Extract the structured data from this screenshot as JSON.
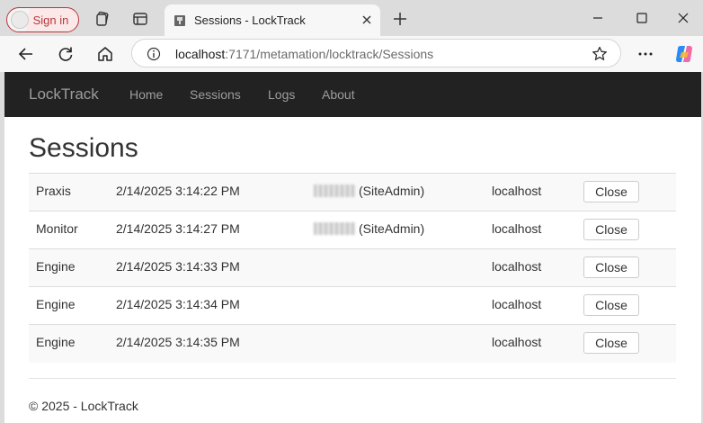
{
  "browser": {
    "sign_in_label": "Sign in",
    "tab_title": "Sessions - LockTrack",
    "url_host": "localhost",
    "url_rest": ":7171/metamation/locktrack/Sessions"
  },
  "navbar": {
    "brand": "LockTrack",
    "links": [
      "Home",
      "Sessions",
      "Logs",
      "About"
    ]
  },
  "page": {
    "title": "Sessions"
  },
  "sessions": {
    "close_label": "Close",
    "rows": [
      {
        "process": "Praxis",
        "started": "2/14/2025 3:14:22 PM",
        "user_role": "(SiteAdmin)",
        "host": "localhost"
      },
      {
        "process": "Monitor",
        "started": "2/14/2025 3:14:27 PM",
        "user_role": "(SiteAdmin)",
        "host": "localhost"
      },
      {
        "process": "Engine",
        "started": "2/14/2025 3:14:33 PM",
        "user_role": "",
        "host": "localhost"
      },
      {
        "process": "Engine",
        "started": "2/14/2025 3:14:34 PM",
        "user_role": "",
        "host": "localhost"
      },
      {
        "process": "Engine",
        "started": "2/14/2025 3:14:35 PM",
        "user_role": "",
        "host": "localhost"
      }
    ]
  },
  "footer": {
    "text": "© 2025 - LockTrack"
  },
  "colors": {
    "navbar_bg": "#222222",
    "navbar_text": "#9d9d9d",
    "signin_accent": "#b9373a"
  }
}
